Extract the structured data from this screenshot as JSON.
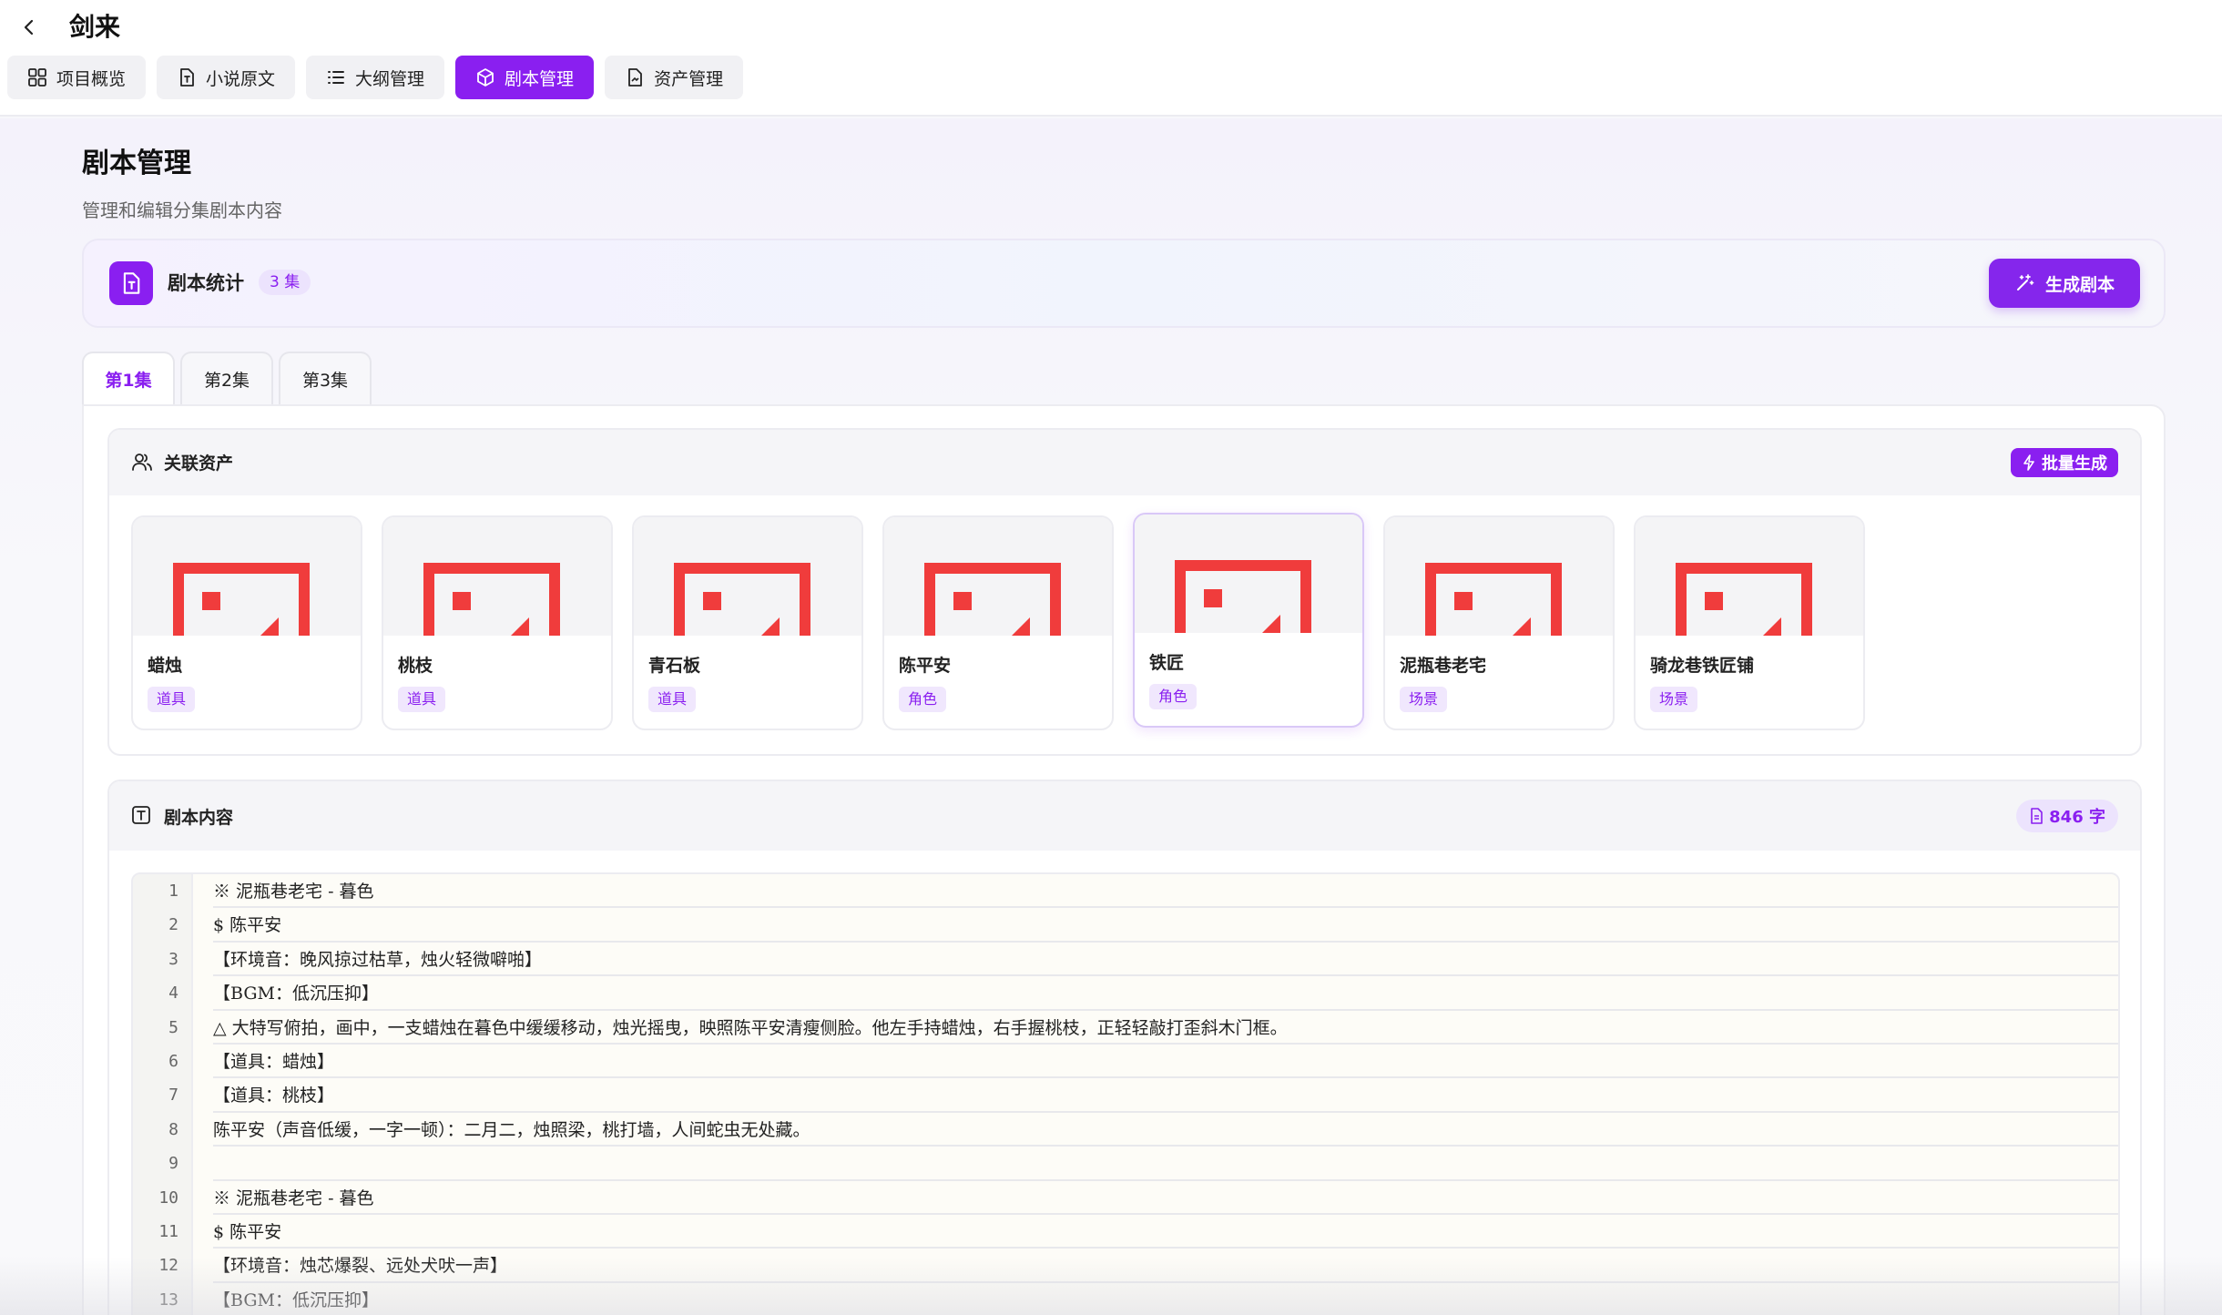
{
  "header": {
    "title": "剑来",
    "tabs": [
      {
        "label": "项目概览",
        "icon": "grid-icon"
      },
      {
        "label": "小说原文",
        "icon": "text-file-icon"
      },
      {
        "label": "大纲管理",
        "icon": "list-icon"
      },
      {
        "label": "剧本管理",
        "icon": "cube-icon",
        "active": true
      },
      {
        "label": "资产管理",
        "icon": "document-icon"
      }
    ]
  },
  "page": {
    "title": "剧本管理",
    "subtitle": "管理和编辑分集剧本内容"
  },
  "stats": {
    "label": "剧本统计",
    "badge": "3 集",
    "generate_label": "生成剧本"
  },
  "episodes": [
    {
      "label": "第1集",
      "active": true
    },
    {
      "label": "第2集"
    },
    {
      "label": "第3集"
    }
  ],
  "assets": {
    "title": "关联资产",
    "batch_label": "批量生成",
    "items": [
      {
        "name": "蜡烛",
        "tag": "道具"
      },
      {
        "name": "桃枝",
        "tag": "道具"
      },
      {
        "name": "青石板",
        "tag": "道具"
      },
      {
        "name": "陈平安",
        "tag": "角色"
      },
      {
        "name": "铁匠",
        "tag": "角色"
      },
      {
        "name": "泥瓶巷老宅",
        "tag": "场景"
      },
      {
        "name": "骑龙巷铁匠铺",
        "tag": "场景"
      }
    ]
  },
  "script": {
    "title": "剧本内容",
    "word_count": "846 字",
    "lines": [
      {
        "n": "1",
        "text": "※ 泥瓶巷老宅 - 暮色"
      },
      {
        "n": "2",
        "text": "$ 陈平安"
      },
      {
        "n": "3",
        "text": "【环境音：晚风掠过枯草，烛火轻微噼啪】"
      },
      {
        "n": "4",
        "text": "【BGM：低沉压抑】"
      },
      {
        "n": "5",
        "text": "△ 大特写俯拍，画中，一支蜡烛在暮色中缓缓移动，烛光摇曳，映照陈平安清瘦侧脸。他左手持蜡烛，右手握桃枝，正轻轻敲打歪斜木门框。"
      },
      {
        "n": "6",
        "text": "【道具：蜡烛】"
      },
      {
        "n": "7",
        "text": "【道具：桃枝】"
      },
      {
        "n": "8",
        "text": "陈平安（声音低缓，一字一顿）：二月二，烛照梁，桃打墙，人间蛇虫无处藏。"
      },
      {
        "n": "9",
        "text": ""
      },
      {
        "n": "10",
        "text": "※ 泥瓶巷老宅 - 暮色"
      },
      {
        "n": "11",
        "text": "$ 陈平安"
      },
      {
        "n": "12",
        "text": "【环境音：烛芯爆裂、远处犬吠一声】"
      },
      {
        "n": "13",
        "text": "【BGM：低沉压抑】"
      }
    ]
  },
  "colors": {
    "accent": "#8a1ff0",
    "placeholder_red": "#f03c3c"
  }
}
